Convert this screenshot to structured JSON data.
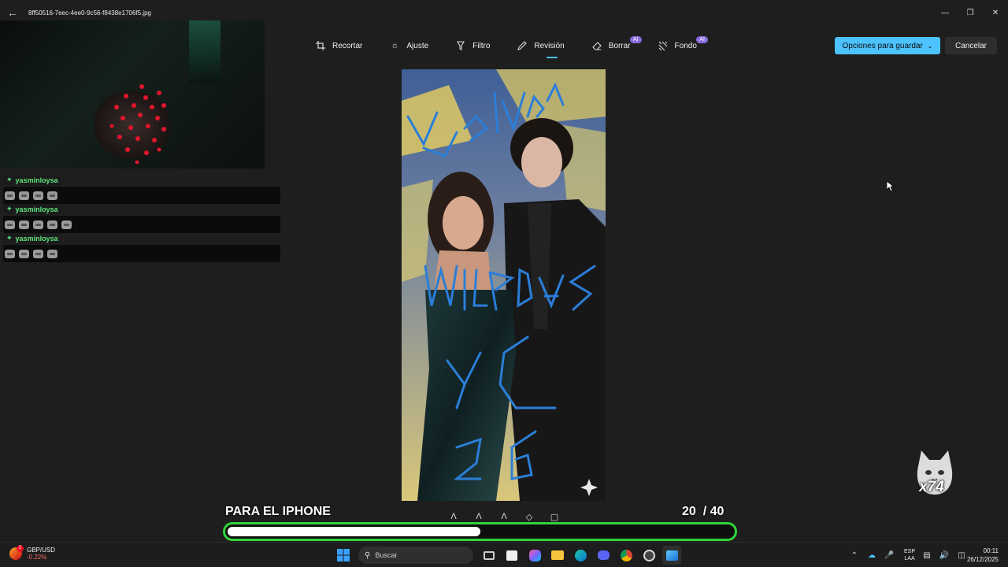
{
  "window": {
    "title": "8ff50516-7eec-4ee0-9c56-f8438e1706f5.jpg"
  },
  "toolbar": {
    "tools": [
      {
        "label": "Recortar",
        "icon": "crop-icon",
        "ai": ""
      },
      {
        "label": "Ajuste",
        "icon": "brightness-icon",
        "ai": ""
      },
      {
        "label": "Filtro",
        "icon": "filter-icon",
        "ai": ""
      },
      {
        "label": "Revisión",
        "icon": "pen-icon",
        "ai": ""
      },
      {
        "label": "Borrar",
        "icon": "eraser-icon",
        "ai": "AI"
      },
      {
        "label": "Fondo",
        "icon": "background-icon",
        "ai": "AI"
      }
    ],
    "active_tool": "Revisión",
    "save_label": "Opciones para guardar",
    "cancel_label": "Cancelar"
  },
  "chat": {
    "messages": [
      {
        "user": "yasminloysa",
        "emote_count": 4
      },
      {
        "user": "yasminloysa",
        "emote_count": 5
      },
      {
        "user": "yasminloysa",
        "emote_count": 4
      }
    ]
  },
  "photo": {
    "annotations": [
      "vuelvan",
      "mierdas",
      "y c",
      "26"
    ]
  },
  "overlay": {
    "cat_count": "x74",
    "goal_title": "PARA EL IPHONE",
    "goal_current": "20",
    "goal_total": "/ 40",
    "goal_progress": 0.5
  },
  "taskbar": {
    "widget_title": "GBP/USD",
    "widget_change": "-0.22%",
    "widget_badge": "2",
    "search_placeholder": "Buscar",
    "lang_line1": "ESP",
    "lang_line2": "LAA",
    "time": "00:11",
    "date": "26/12/2025"
  },
  "colors": {
    "accent": "#4cc2ff",
    "ai_badge": "#8a6be0",
    "goal_border": "#31d53a",
    "chat_user": "#5ee37a"
  }
}
